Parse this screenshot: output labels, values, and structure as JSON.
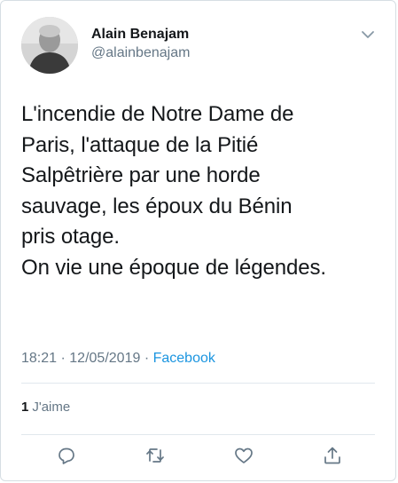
{
  "tweet": {
    "author": {
      "display_name": "Alain Benajam",
      "handle": "@alainbenajam"
    },
    "text": "L'incendie de Notre Dame de\nParis, l'attaque de la Pitié\nSalpêtrière par une horde\nsauvage, les époux du Bénin\npris otage.\nOn vie une époque de légendes.",
    "time": "18:21",
    "date": "12/05/2019",
    "separator": "·",
    "source": "Facebook",
    "likes": {
      "count": "1",
      "label": "J'aime"
    }
  },
  "icons": {
    "caret": "chevron-down-icon",
    "reply": "reply-icon",
    "retweet": "retweet-icon",
    "like": "heart-icon",
    "share": "share-icon"
  },
  "colors": {
    "text": "#14171a",
    "secondary": "#657786",
    "link": "#1b95e0",
    "border": "#e1e8ed"
  }
}
